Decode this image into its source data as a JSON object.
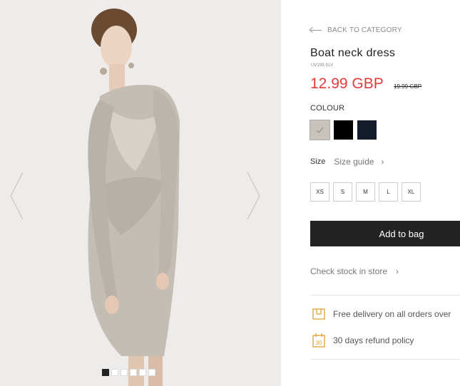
{
  "product": {
    "back_label": "BACK TO CATEGORY",
    "title": "Boat neck dress",
    "sku": "UV199-SLV",
    "price": "12.99 GBP",
    "old_price": "19.99 GBP",
    "colour_label": "COLOUR",
    "colours": [
      {
        "name": "silver-grey",
        "hex": "#c9c3bc",
        "selected": true
      },
      {
        "name": "black",
        "hex": "#000000",
        "selected": false
      },
      {
        "name": "navy",
        "hex": "#141b2b",
        "selected": false
      }
    ],
    "size_label": "Size",
    "size_guide": "Size guide",
    "sizes": [
      "XS",
      "S",
      "M",
      "L",
      "XL"
    ],
    "add_to_bag": "Add to bag",
    "check_stock": "Check stock in store",
    "delivery": "Free delivery on all orders over",
    "refund": "30 days refund policy",
    "refund_icon_text": "30",
    "chevron": "›"
  },
  "gallery": {
    "slide_count": 6,
    "active_slide": 1
  },
  "colors": {
    "accent_price": "#e23b3b",
    "icon_gold": "#e0a030",
    "button_dark": "#222222"
  }
}
